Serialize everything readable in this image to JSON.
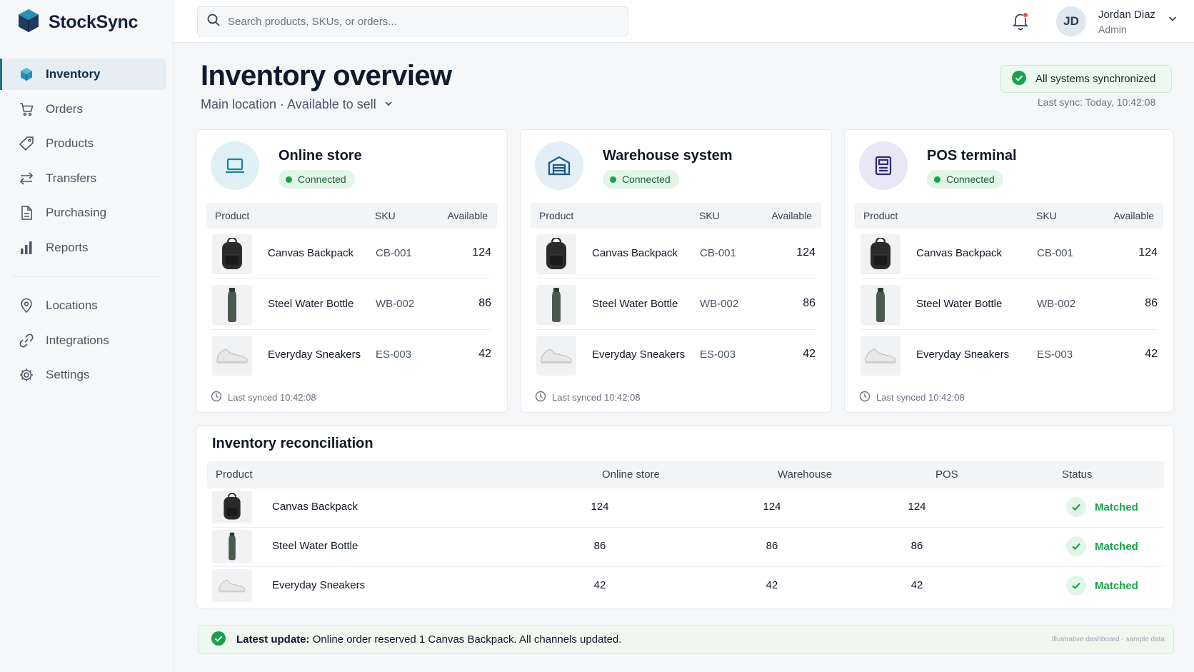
{
  "app": {
    "name": "StockSync"
  },
  "sidebar": {
    "items": [
      {
        "label": "Inventory",
        "icon": "box-icon",
        "active": true
      },
      {
        "label": "Orders",
        "icon": "cart-icon"
      },
      {
        "label": "Products",
        "icon": "tag-icon"
      },
      {
        "label": "Transfers",
        "icon": "arrows-icon"
      },
      {
        "label": "Purchasing",
        "icon": "document-icon"
      },
      {
        "label": "Reports",
        "icon": "bar-chart-icon"
      }
    ],
    "secondary": [
      {
        "label": "Locations",
        "icon": "map-pin-icon"
      },
      {
        "label": "Integrations",
        "icon": "link-icon"
      },
      {
        "label": "Settings",
        "icon": "gear-icon"
      }
    ]
  },
  "topbar": {
    "search_placeholder": "Search products, SKUs, or orders...",
    "user": {
      "initials": "JD",
      "name": "Jordan Diaz",
      "role": "Admin"
    }
  },
  "header": {
    "title": "Inventory overview",
    "subtitle": "Main location · Available to sell",
    "sync_status": "All systems synchronized",
    "last_sync": "Last sync: Today, 10:42:08"
  },
  "channels": [
    {
      "title": "Online store",
      "status": "Connected",
      "icon": "laptop-icon",
      "columns": [
        "Product",
        "SKU",
        "Available"
      ],
      "rows": [
        {
          "product": "Canvas Backpack",
          "sku": "CB-001",
          "available": "124"
        },
        {
          "product": "Steel Water Bottle",
          "sku": "WB-002",
          "available": "86"
        },
        {
          "product": "Everyday Sneakers",
          "sku": "ES-003",
          "available": "42"
        }
      ],
      "last_synced": "Last synced 10:42:08"
    },
    {
      "title": "Warehouse system",
      "status": "Connected",
      "icon": "warehouse-icon",
      "columns": [
        "Product",
        "SKU",
        "Available"
      ],
      "rows": [
        {
          "product": "Canvas Backpack",
          "sku": "CB-001",
          "available": "124"
        },
        {
          "product": "Steel Water Bottle",
          "sku": "WB-002",
          "available": "86"
        },
        {
          "product": "Everyday Sneakers",
          "sku": "ES-003",
          "available": "42"
        }
      ],
      "last_synced": "Last synced 10:42:08"
    },
    {
      "title": "POS terminal",
      "status": "Connected",
      "icon": "pos-terminal-icon",
      "columns": [
        "Product",
        "SKU",
        "Available"
      ],
      "rows": [
        {
          "product": "Canvas Backpack",
          "sku": "CB-001",
          "available": "124"
        },
        {
          "product": "Steel Water Bottle",
          "sku": "WB-002",
          "available": "86"
        },
        {
          "product": "Everyday Sneakers",
          "sku": "ES-003",
          "available": "42"
        }
      ],
      "last_synced": "Last synced 10:42:08"
    }
  ],
  "reconciliation": {
    "title": "Inventory reconciliation",
    "columns": [
      "Product",
      "Online store",
      "Warehouse",
      "POS",
      "Status"
    ],
    "rows": [
      {
        "product": "Canvas Backpack",
        "online": "124",
        "warehouse": "124",
        "pos": "124",
        "status": "Matched"
      },
      {
        "product": "Steel Water Bottle",
        "online": "86",
        "warehouse": "86",
        "pos": "86",
        "status": "Matched"
      },
      {
        "product": "Everyday Sneakers",
        "online": "42",
        "warehouse": "42",
        "pos": "42",
        "status": "Matched"
      }
    ]
  },
  "banner": {
    "label": "Latest update:",
    "message": "Online order reserved 1 Canvas Backpack. All channels updated.",
    "note": "Illustrative dashboard · sample data"
  },
  "colors": {
    "accent": "#1f6f8b",
    "success": "#16a34a",
    "brand": "#16213e"
  }
}
